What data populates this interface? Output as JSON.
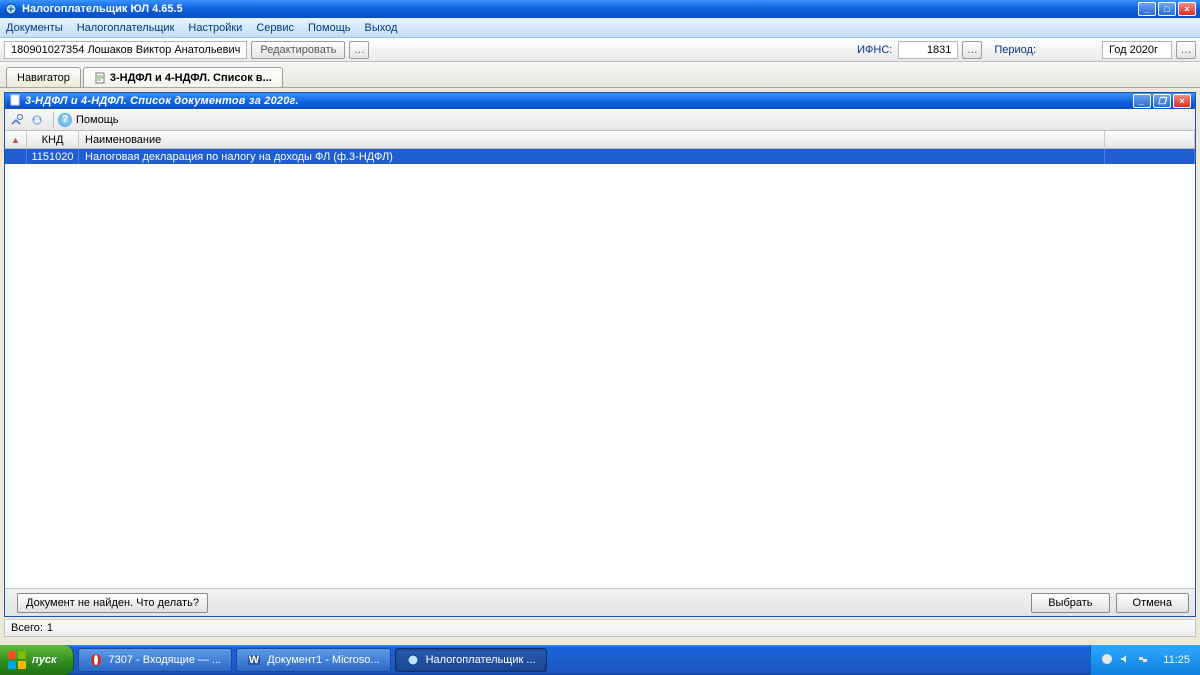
{
  "window": {
    "title": "Налогоплательщик ЮЛ 4.65.5"
  },
  "menu": {
    "items": [
      "Документы",
      "Налогоплательщик",
      "Настройки",
      "Сервис",
      "Помощь",
      "Выход"
    ]
  },
  "infobar": {
    "taxpayer": "180901027354 Лошаков Виктор Анатольевич",
    "edit_btn": "Редактировать",
    "ifns_label": "ИФНС:",
    "ifns_value": "1831",
    "period_label": "Период:",
    "year_value": "Год 2020г"
  },
  "tabs": {
    "navigator": "Навигатор",
    "active": "3-НДФЛ и 4-НДФЛ. Список в..."
  },
  "child": {
    "title": "3-НДФЛ и 4-НДФЛ. Список документов за 2020г.",
    "help_label": "Помощь",
    "columns": {
      "knd": "КНД",
      "name": "Наименование"
    },
    "row": {
      "knd": "1151020",
      "name": "Налоговая декларация по налогу на доходы ФЛ (ф.3-НДФЛ)"
    },
    "docnotfound": "Документ не найден. Что делать?",
    "select_btn": "Выбрать",
    "cancel_btn": "Отмена"
  },
  "status": {
    "total_label": "Всего:",
    "total_value": "1"
  },
  "taskbar": {
    "start": "пуск",
    "btn1": "7307 - Входящие — ...",
    "btn2": "Документ1 - Microso...",
    "btn3": "Налогоплательщик ...",
    "clock": "11:25"
  }
}
